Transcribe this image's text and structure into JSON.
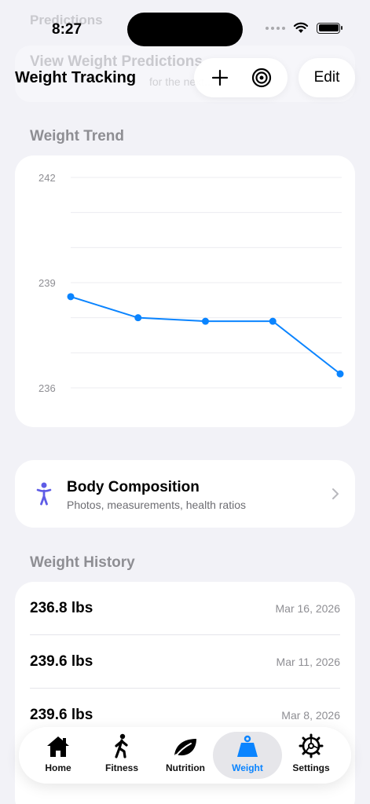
{
  "ghost": {
    "section": "Predictions",
    "title": "View Weight Predictions",
    "subtitle": "for the next..."
  },
  "status_bar": {
    "time": "8:27"
  },
  "nav": {
    "title": "Weight Tracking",
    "edit_label": "Edit"
  },
  "sections": {
    "trend": "Weight Trend",
    "history": "Weight History"
  },
  "colors": {
    "accent": "#0a84ff",
    "background": "#f2f2f7",
    "body_icon": "#5e5ce6"
  },
  "chart_data": {
    "type": "line",
    "y_ticks": [
      242,
      239,
      236
    ],
    "ylim": [
      236,
      242
    ],
    "grid": true,
    "series": [
      {
        "values": [
          238.6,
          238.0,
          237.9,
          237.9,
          236.4
        ]
      }
    ]
  },
  "body_composition": {
    "title": "Body Composition",
    "subtitle": "Photos, measurements, health ratios"
  },
  "history": [
    {
      "weight": "236.8 lbs",
      "date": "Mar 16, 2026"
    },
    {
      "weight": "239.6 lbs",
      "date": "Mar 11, 2026"
    },
    {
      "weight": "239.6 lbs",
      "date": "Mar 8, 2026"
    }
  ],
  "tabs": [
    {
      "label": "Home",
      "icon": "house-icon"
    },
    {
      "label": "Fitness",
      "icon": "walking-figure-icon"
    },
    {
      "label": "Nutrition",
      "icon": "leaf-icon"
    },
    {
      "label": "Weight",
      "icon": "scale-weight-icon",
      "active": true
    },
    {
      "label": "Settings",
      "icon": "gear-icon"
    }
  ]
}
